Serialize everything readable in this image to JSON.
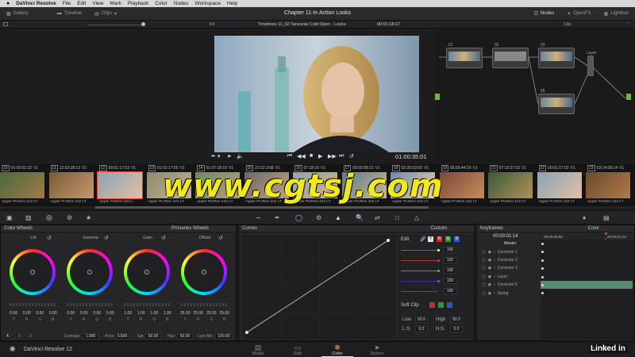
{
  "menubar": {
    "items": [
      "DaVinci Resolve",
      "File",
      "Edit",
      "View",
      "Mark",
      "Playback",
      "Color",
      "Nodes",
      "Workspace",
      "Help"
    ]
  },
  "topbar": {
    "title": "Chapter 11-In Action Looks",
    "gallery": "Gallery",
    "timeline": "Timeline",
    "clips": "Clips",
    "nodes": "Nodes",
    "openfx": "OpenFX",
    "lightbox": "Lightbox"
  },
  "viewerbar": {
    "fit": "Fit",
    "timeline_name": "Timelines 11_02 Tanzania Cold Open - Looks",
    "timecode": "00:01:18:17",
    "clip_mode": "Clip"
  },
  "transport": {
    "timecode": "01:00:35:01"
  },
  "nodes": {
    "labels": [
      "01",
      "02",
      "03",
      "04",
      "05"
    ],
    "layer_label": "Layer"
  },
  "clips": [
    {
      "num": "10",
      "tc": "01:00:01:22",
      "track": "V1",
      "codec": "Apple ProRes 422 LT"
    },
    {
      "num": "11",
      "tc": "12:03:28:13",
      "track": "V1",
      "codec": "Apple ProRes 422 LT"
    },
    {
      "num": "12",
      "tc": "00:01:17:03",
      "track": "V1",
      "codec": "Apple ProRes 422 L"
    },
    {
      "num": "13",
      "tc": "01:02:17:05",
      "track": "V1",
      "codec": "Apple ProRes 422 LT"
    },
    {
      "num": "14",
      "tc": "01:07:18:10",
      "track": "V1",
      "codec": "Apple ProRes 422 LT"
    },
    {
      "num": "15",
      "tc": "21:52:3:08",
      "track": "V1",
      "codec": "Apple ProRes 422 LT"
    },
    {
      "num": "16",
      "tc": "07:18:16",
      "track": "V1",
      "codec": "Apple ProRes 422 LT"
    },
    {
      "num": "17",
      "tc": "00:03:08:22",
      "track": "V1",
      "codec": "Apple ProRes 422 LT"
    },
    {
      "num": "18",
      "tc": "02:26:03:00",
      "track": "V1",
      "codec": "Apple ProRes 422 LT"
    },
    {
      "num": "19",
      "tc": "06:56:44:20",
      "track": "V1",
      "codec": "Apple ProRes 422 LT"
    },
    {
      "num": "21",
      "tc": "07:19:27:02",
      "track": "V1",
      "codec": "Apple ProRes 422 LT"
    },
    {
      "num": "22",
      "tc": "00:01:17:03",
      "track": "V1",
      "codec": "Apple ProRes 422 LT"
    },
    {
      "num": "23",
      "tc": "03:14:08:14",
      "track": "V1",
      "codec": "Apple ProRes 422 LT"
    }
  ],
  "watermark": "www.cgtsj.com",
  "color_wheels": {
    "title": "Color Wheels",
    "mode": "Primaries Wheels",
    "wheels": [
      {
        "name": "Lift",
        "values": [
          "0.00",
          "0.00",
          "0.00",
          "0.00"
        ]
      },
      {
        "name": "Gamma",
        "values": [
          "0.00",
          "0.00",
          "0.00",
          "0.00"
        ]
      },
      {
        "name": "Gain",
        "values": [
          "1.00",
          "1.00",
          "1.00",
          "1.00"
        ]
      },
      {
        "name": "Offset",
        "values": [
          "25.00",
          "25.00",
          "25.00",
          "25.00"
        ]
      }
    ],
    "channels": [
      "Y",
      "R",
      "G",
      "B"
    ],
    "bottom": {
      "a": "A",
      "p1": "1",
      "p2": "2",
      "contrast_label": "Contrast",
      "contrast": "1.000",
      "pivot_label": "Pivot",
      "pivot": "0.500",
      "sat_label": "Sat",
      "sat": "50.00",
      "hue_label": "Hue",
      "hue": "50.00",
      "lummix_label": "Lum Mix",
      "lummix": "100.00"
    }
  },
  "curves": {
    "title": "Curves",
    "mode": "Custom",
    "edit_label": "Edit",
    "channels": [
      "Y",
      "R",
      "G",
      "B"
    ],
    "channel_values": [
      "100",
      "100",
      "100",
      "100",
      "100"
    ],
    "soft_clip_label": "Soft Clip",
    "low_label": "Low",
    "low": "50.0",
    "high_label": "High",
    "high": "50.0",
    "ls_label": "L.S.",
    "ls": "0.0",
    "hs_label": "H.S.",
    "hs": "0.0"
  },
  "keyframes": {
    "title": "Keyframes",
    "mode": "Color",
    "timecode_left": "00:00:01:14",
    "ruler_start": "00:00:00:00",
    "ruler_end": "00:00:01:16",
    "rows": [
      "Master",
      "Corrector 1",
      "Corrector 2",
      "Corrector 3",
      "Layer",
      "Corrector 5",
      "Sizing"
    ]
  },
  "pagebar": {
    "app": "DaVinci Resolve 12",
    "pages": [
      "Media",
      "Edit",
      "Color",
      "Deliver"
    ],
    "active": "Color",
    "brand": "Linked in"
  },
  "colors": {
    "accent": "#e8412c",
    "keyframe_highlight": "#5a8a72",
    "node_green": "#78b23f",
    "watermark": "#f2e91c"
  }
}
